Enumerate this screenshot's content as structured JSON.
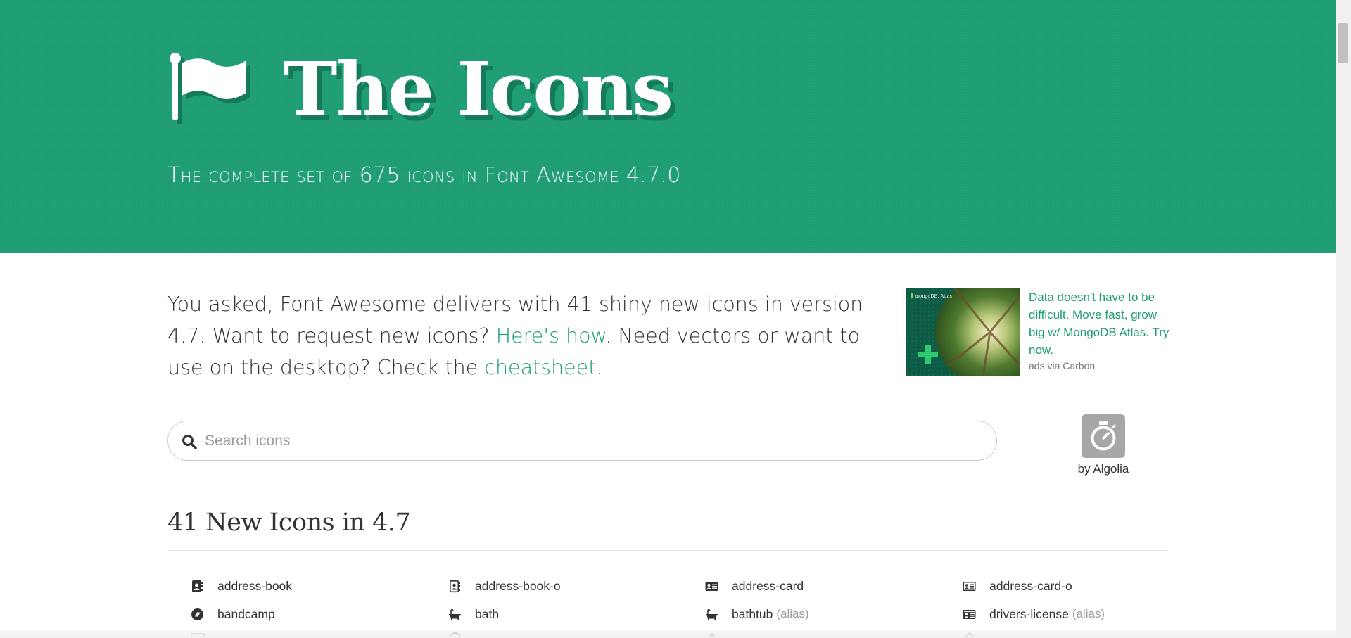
{
  "header": {
    "flag_icon": "flag-icon",
    "title": "The Icons",
    "subtitle": "The complete set of 675 icons in Font Awesome 4.7.0"
  },
  "intro": {
    "part1": "You asked, Font Awesome delivers with 41 shiny new icons in version 4.7. Want to request new icons? ",
    "link1": "Here's how",
    "part2": ". Need vectors or want to use on the desktop? Check the ",
    "link2": "cheatsheet",
    "part3": "."
  },
  "ad": {
    "logo_text": "mongoDB. Atlas",
    "text": "Data doesn't have to be difficult. Move fast, grow big w/ MongoDB Atlas. Try now.",
    "via": "ads via Carbon"
  },
  "search": {
    "placeholder": "Search icons",
    "value": "",
    "icon": "search-icon"
  },
  "algolia": {
    "icon": "stopwatch-icon",
    "label": "by Algolia"
  },
  "section": {
    "heading": "41 New Icons in 4.7"
  },
  "icons": [
    {
      "name": "address-book",
      "alias": "",
      "icon": "address-book-icon"
    },
    {
      "name": "address-book-o",
      "alias": "",
      "icon": "address-book-o-icon"
    },
    {
      "name": "address-card",
      "alias": "",
      "icon": "address-card-icon"
    },
    {
      "name": "address-card-o",
      "alias": "",
      "icon": "address-card-o-icon"
    },
    {
      "name": "bandcamp",
      "alias": "",
      "icon": "bandcamp-icon"
    },
    {
      "name": "bath",
      "alias": "",
      "icon": "bath-icon"
    },
    {
      "name": "bathtub",
      "alias": "(alias)",
      "icon": "bathtub-icon"
    },
    {
      "name": "drivers-license",
      "alias": "(alias)",
      "icon": "drivers-license-icon"
    }
  ],
  "colors": {
    "brand_green": "#1f9d75",
    "brand_green_dark": "#157a5a",
    "text": "#333333",
    "muted": "#999999"
  }
}
